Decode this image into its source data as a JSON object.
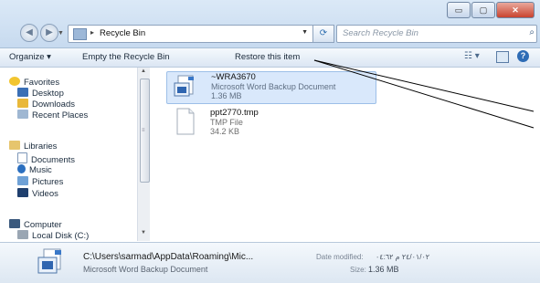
{
  "window": {
    "buttons": {
      "minimize": "▭",
      "maximize": "▢",
      "close": "✕"
    }
  },
  "address_bar": {
    "crumb_arrow": "▸",
    "location": "Recycle Bin",
    "search_placeholder": "Search Recycle Bin"
  },
  "toolbar": {
    "organize": "Organize ▾",
    "empty": "Empty the Recycle Bin",
    "restore": "Restore this item",
    "views": "☷ ▾",
    "help": "?"
  },
  "sidebar": {
    "favorites": "Favorites",
    "desktop": "Desktop",
    "downloads": "Downloads",
    "recent": "Recent Places",
    "libraries": "Libraries",
    "documents": "Documents",
    "music": "Music",
    "pictures": "Pictures",
    "videos": "Videos",
    "computer": "Computer",
    "local_disk": "Local Disk (C:)"
  },
  "files": [
    {
      "name": "~WRA3670",
      "type": "Microsoft Word Backup Document",
      "size": "1.36 MB"
    },
    {
      "name": "ppt2770.tmp",
      "type": "TMP File",
      "size": "34.2 KB"
    }
  ],
  "details": {
    "path": "C:\\Users\\sarmad\\AppData\\Roaming\\Mic...",
    "type": "Microsoft Word Backup Document",
    "date_label": "Date modified:",
    "date_value": "٢٤/٠١/٠٢ م ٠٤:٦٢",
    "size_label": "Size:",
    "size_value": "1.36 MB"
  },
  "icons": {
    "back": "arrow-left-icon",
    "forward": "arrow-right-icon",
    "refresh": "refresh-icon",
    "search": "search-icon"
  },
  "colors": {
    "selection": "#d9e8fb",
    "chrome": "#c7daef"
  }
}
